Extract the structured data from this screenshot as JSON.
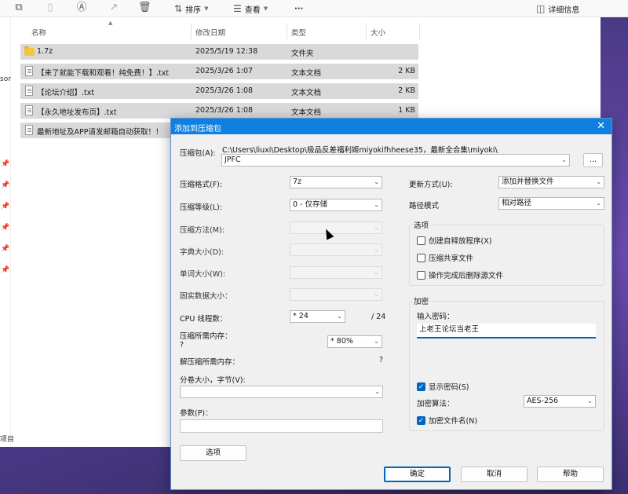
{
  "explorer": {
    "toolbar": {
      "sort_label": "排序",
      "view_label": "查看",
      "more_label": "···",
      "details_label": "详细信息"
    },
    "columns": {
      "name": "名称",
      "modified": "修改日期",
      "type": "类型",
      "size": "大小"
    },
    "files": [
      {
        "name": "1.7z",
        "modified": "2025/5/19 12:38",
        "type": "文件夹",
        "size": "",
        "kind": "folder"
      },
      {
        "name": "【来了就能下载和观看！纯免费！】.txt",
        "modified": "2025/3/26 1:07",
        "type": "文本文档",
        "size": "2 KB",
        "kind": "file"
      },
      {
        "name": "【论坛介绍】.txt",
        "modified": "2025/3/26 1:08",
        "type": "文本文档",
        "size": "2 KB",
        "kind": "file"
      },
      {
        "name": "【永久地址发布页】.txt",
        "modified": "2025/3/26 1:08",
        "type": "文本文档",
        "size": "1 KB",
        "kind": "file"
      },
      {
        "name": "最新地址及APP请发邮箱自动获取！！",
        "modified": "",
        "type": "",
        "size": "",
        "kind": "file"
      }
    ],
    "sidebar_text_top": "sor",
    "status_text": "项目"
  },
  "dialog": {
    "title": "添加到压缩包",
    "archive_label": "压缩包(A):",
    "archive_path": "C:\\Users\\liuxi\\Desktop\\极品反差福利姬miyokifhheese35，最新全合集\\miyoki\\",
    "archive_name": "JPFC",
    "browse_label": "...",
    "format_label": "压缩格式(F):",
    "format_value": "7z",
    "level_label": "压缩等级(L):",
    "level_value": "0 - 仅存储",
    "method_label": "压缩方法(M):",
    "dict_label": "字典大小(D):",
    "word_label": "单词大小(W):",
    "solid_label": "固实数据大小：",
    "threads_label": "CPU 线程数：",
    "threads_value": "* 24",
    "threads_total": "/ 24",
    "mem_label": "压缩所需内存：",
    "mem_q": "?",
    "mem_value": "* 80%",
    "decomp_label": "解压缩所需内存：",
    "decomp_q": "?",
    "split_label": "分卷大小，字节(V):",
    "params_label": "参数(P)：",
    "options_button": "选项",
    "update_label": "更新方式(U):",
    "update_value": "添加并替换文件",
    "pathmode_label": "路径模式",
    "pathmode_value": "相对路径",
    "options_group": "选项",
    "opt_sfx": "创建自释放程序(X)",
    "opt_shared": "压缩共享文件",
    "opt_delete": "操作完成后删除源文件",
    "encrypt_group": "加密",
    "pw_label": "输入密码：",
    "pw_value": "上老王论坛当老王",
    "show_pw": "显示密码(S)",
    "enc_method_label": "加密算法：",
    "enc_method_value": "AES-256",
    "enc_names": "加密文件名(N)",
    "ok": "确定",
    "cancel": "取消",
    "help": "帮助"
  }
}
